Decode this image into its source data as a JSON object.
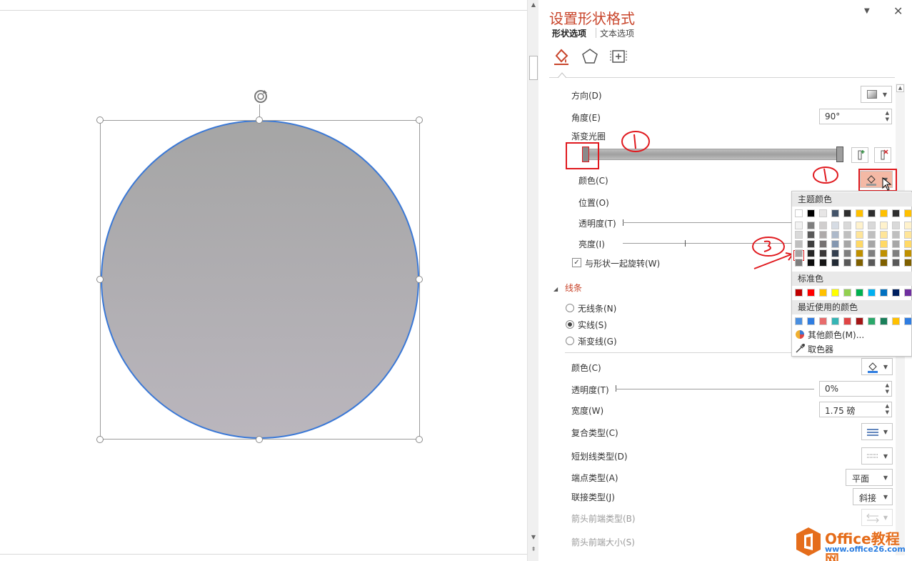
{
  "pane": {
    "title": "设置形状格式",
    "tabs": [
      "形状选项",
      "文本选项"
    ],
    "fill": {
      "direction_label": "方向(D)",
      "angle_label": "角度(E)",
      "angle_value": "90°",
      "gradient_stops_label": "渐变光圈",
      "color_label": "颜色(C)",
      "position_label": "位置(O)",
      "transparency_label": "透明度(T)",
      "brightness_label": "亮度(I)",
      "rotate_with_shape_label": "与形状一起旋转(W)",
      "rotate_with_shape_checked": true
    },
    "line": {
      "section_title": "线条",
      "no_line_label": "无线条(N)",
      "solid_line_label": "实线(S)",
      "gradient_line_label": "渐变线(G)",
      "selected": "solid",
      "color_label": "颜色(C)",
      "transparency_label": "透明度(T)",
      "transparency_value": "0%",
      "width_label": "宽度(W)",
      "width_value": "1.75 磅",
      "compound_label": "复合类型(C)",
      "dash_label": "短划线类型(D)",
      "cap_label": "端点类型(A)",
      "cap_value": "平面",
      "join_label": "联接类型(J)",
      "join_value": "斜接",
      "arrow_begin_type_label": "箭头前端类型(B)",
      "arrow_begin_size_label": "箭头前端大小(S)"
    }
  },
  "color_popup": {
    "theme_colors_label": "主题颜色",
    "standard_colors_label": "标准色",
    "recent_colors_label": "最近使用的颜色",
    "more_colors_label": "其他颜色(M)...",
    "eyedropper_label": "取色器",
    "theme_top_row": [
      "#ffffff",
      "#000000",
      "#e7e6e6",
      "#44546a",
      "#2f2f2f",
      "#ffc000",
      "#2f2f2f",
      "#ffc000",
      "#2f2f2f",
      "#ffc000"
    ],
    "theme_shades": [
      [
        "#f2f2f2",
        "#7f7f7f",
        "#d0cece",
        "#d6dce4",
        "#d9d9d9",
        "#fff2cc",
        "#d9d9d9",
        "#fff2cc",
        "#d9d9d9",
        "#fff2cc"
      ],
      [
        "#d9d9d9",
        "#595959",
        "#aeaaaa",
        "#adb9ca",
        "#bfbfbf",
        "#ffe599",
        "#bfbfbf",
        "#ffe599",
        "#bfbfbf",
        "#ffe599"
      ],
      [
        "#bfbfbf",
        "#3f3f3f",
        "#757171",
        "#8497b0",
        "#a6a6a6",
        "#ffd966",
        "#a6a6a6",
        "#ffd966",
        "#a6a6a6",
        "#ffd966"
      ],
      [
        "#a5a5a5",
        "#262626",
        "#3a3838",
        "#333f4f",
        "#7f7f7f",
        "#bf9000",
        "#7f7f7f",
        "#bf9000",
        "#7f7f7f",
        "#bf9000"
      ],
      [
        "#7f7f7f",
        "#0d0d0d",
        "#171616",
        "#222a35",
        "#595959",
        "#7f6000",
        "#595959",
        "#7f6000",
        "#595959",
        "#7f6000"
      ]
    ],
    "standard_colors": [
      "#c00000",
      "#ff0000",
      "#ffc000",
      "#ffff00",
      "#92d050",
      "#00b050",
      "#00b0f0",
      "#0070c0",
      "#002060",
      "#7030a0"
    ],
    "recent_colors": [
      "#4a8fe0",
      "#2f7de1",
      "#e86c6c",
      "#36b5b5",
      "#e04545",
      "#a31515",
      "#2aa86a",
      "#1a7f5a",
      "#ffc000",
      "#2f7de1"
    ]
  },
  "annotations": {
    "mark1": "①",
    "mark2": "①",
    "mark3": "③"
  },
  "watermark": {
    "title": "Office教程网",
    "url": "www.office26.com"
  }
}
